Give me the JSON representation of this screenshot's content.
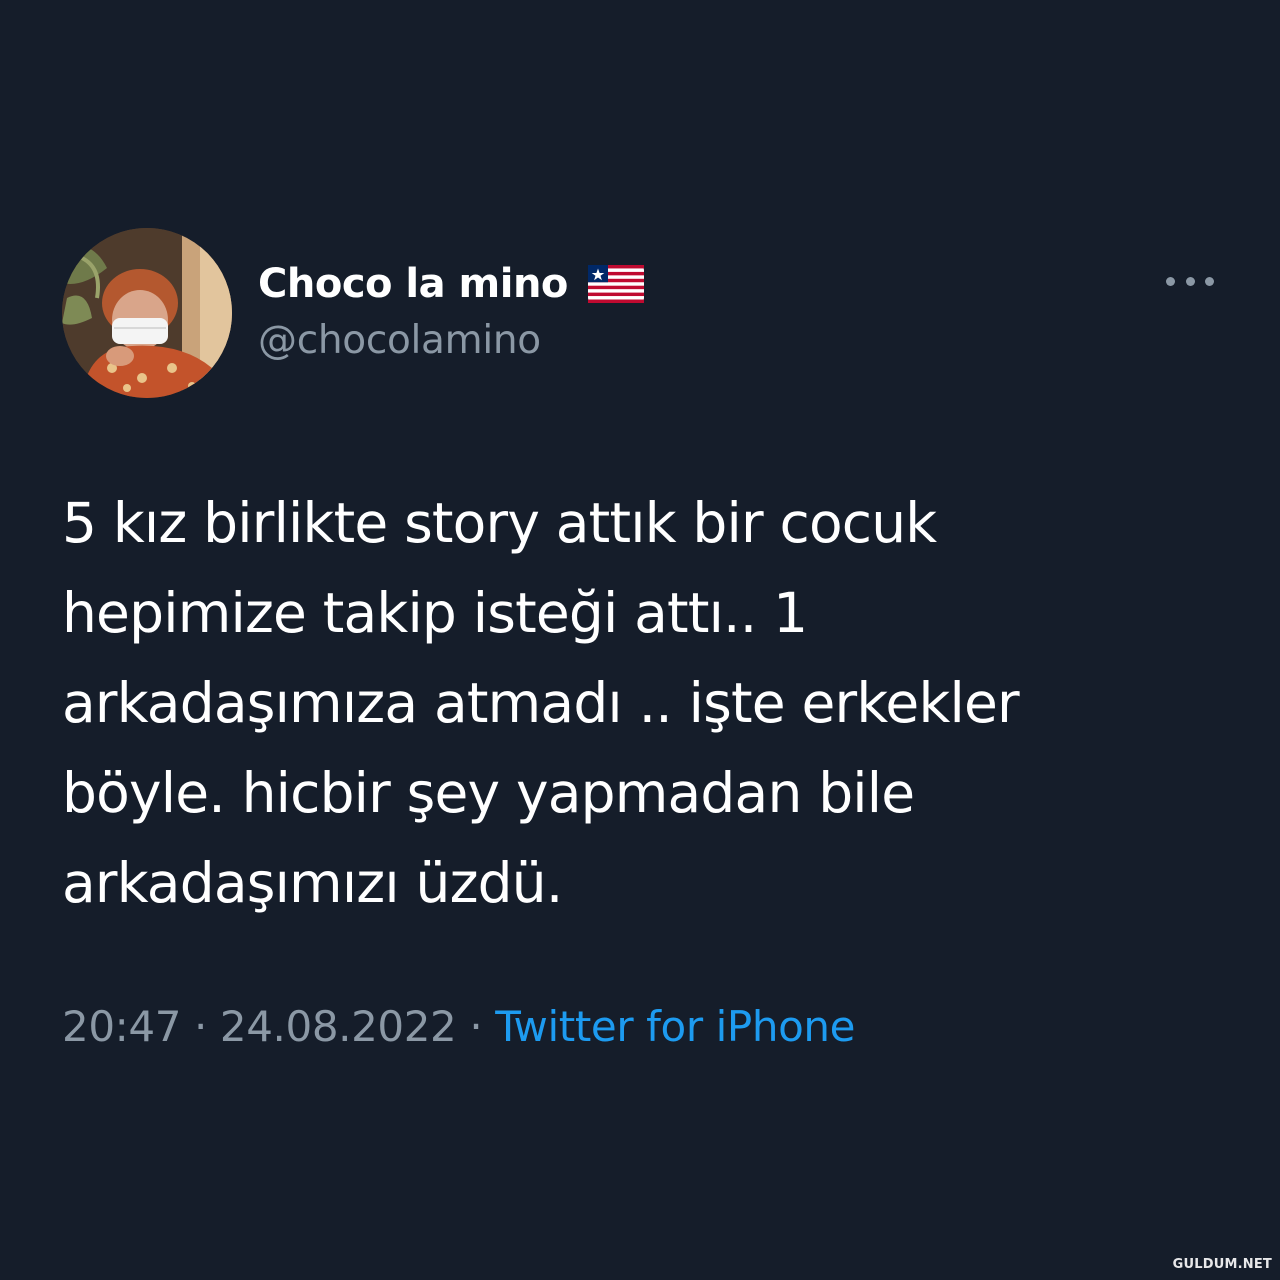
{
  "tweet": {
    "author": {
      "display_name": "Choco la mino",
      "handle": "@chocolamino",
      "flag_icon": "flag-liberia-icon",
      "avatar_icon": "profile-photo"
    },
    "more_icon": "more-options-icon",
    "text_lines": [
      "5 kız birlikte story attık bir cocuk",
      "hepimize takip isteği attı.. 1",
      "arkadaşımıza atmadı .. işte erkekler",
      "böyle. hicbir şey yapmadan bile",
      "arkadaşımızı üzdü."
    ],
    "time": "20:47",
    "separator": " · ",
    "date": "24.08.2022",
    "source": "Twitter for iPhone"
  },
  "watermark": "GULDUM.NET",
  "colors": {
    "background": "#151d2a",
    "primary_text": "#ffffff",
    "secondary_text": "#8b98a5",
    "link": "#1d9bf0"
  }
}
